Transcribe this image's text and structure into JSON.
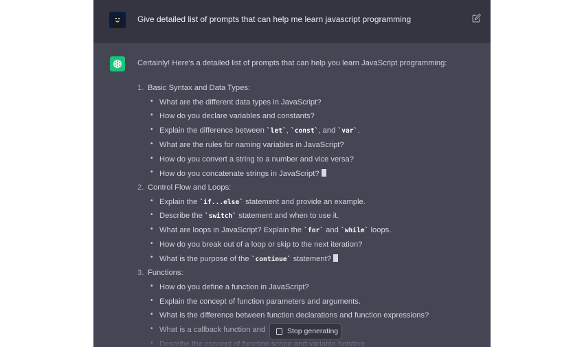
{
  "user_message": {
    "text": "Give detailed list of prompts that can help me learn javascript programming"
  },
  "assistant_message": {
    "intro": "Certainly! Here's a detailed list of prompts that can help you learn JavaScript programming:",
    "sections": [
      {
        "number": "1.",
        "title": "Basic Syntax and Data Types:",
        "items": [
          {
            "parts": [
              {
                "t": "What are the different data types in JavaScript?"
              }
            ]
          },
          {
            "parts": [
              {
                "t": "How do you declare variables and constants?"
              }
            ]
          },
          {
            "parts": [
              {
                "t": "Explain the difference between "
              },
              {
                "c": "`let`"
              },
              {
                "t": ", "
              },
              {
                "c": "`const`"
              },
              {
                "t": ", and "
              },
              {
                "c": "`var`"
              },
              {
                "t": "."
              }
            ]
          },
          {
            "parts": [
              {
                "t": "What are the rules for naming variables in JavaScript?"
              }
            ]
          },
          {
            "parts": [
              {
                "t": "How do you convert a string to a number and vice versa?"
              }
            ]
          },
          {
            "parts": [
              {
                "t": "How do you concatenate strings in JavaScript?"
              }
            ],
            "cursor": true
          }
        ]
      },
      {
        "number": "2.",
        "title": "Control Flow and Loops:",
        "items": [
          {
            "parts": [
              {
                "t": "Explain the "
              },
              {
                "c": "`if...else`"
              },
              {
                "t": " statement and provide an example."
              }
            ]
          },
          {
            "parts": [
              {
                "t": "Describe the "
              },
              {
                "c": "`switch`"
              },
              {
                "t": " statement and when to use it."
              }
            ]
          },
          {
            "parts": [
              {
                "t": "What are loops in JavaScript? Explain the "
              },
              {
                "c": "`for`"
              },
              {
                "t": " and "
              },
              {
                "c": "`while`"
              },
              {
                "t": " loops."
              }
            ]
          },
          {
            "parts": [
              {
                "t": "How do you break out of a loop or skip to the next iteration?"
              }
            ]
          },
          {
            "parts": [
              {
                "t": "What is the purpose of the "
              },
              {
                "c": "`continue`"
              },
              {
                "t": " statement?"
              }
            ],
            "cursor": true
          }
        ]
      },
      {
        "number": "3.",
        "title": "Functions:",
        "items": [
          {
            "parts": [
              {
                "t": "How do you define a function in JavaScript?"
              }
            ]
          },
          {
            "parts": [
              {
                "t": "Explain the concept of function parameters and arguments."
              }
            ]
          },
          {
            "parts": [
              {
                "t": "What is the difference between function declarations and function expressions?"
              }
            ]
          },
          {
            "parts": [
              {
                "t": "What is a callback function and"
              }
            ]
          },
          {
            "parts": [
              {
                "t": "Describe the concept of function scope and variable hoisting"
              }
            ]
          }
        ]
      }
    ]
  },
  "controls": {
    "stop_label": "Stop generating"
  },
  "colors": {
    "user_bg": "#343541",
    "assistant_bg": "#444654",
    "accent": "#19c37d"
  },
  "icons": {
    "user_avatar": "avatar-icon",
    "edit": "edit-icon",
    "assistant_logo": "openai-logo-icon",
    "stop": "stop-icon"
  }
}
